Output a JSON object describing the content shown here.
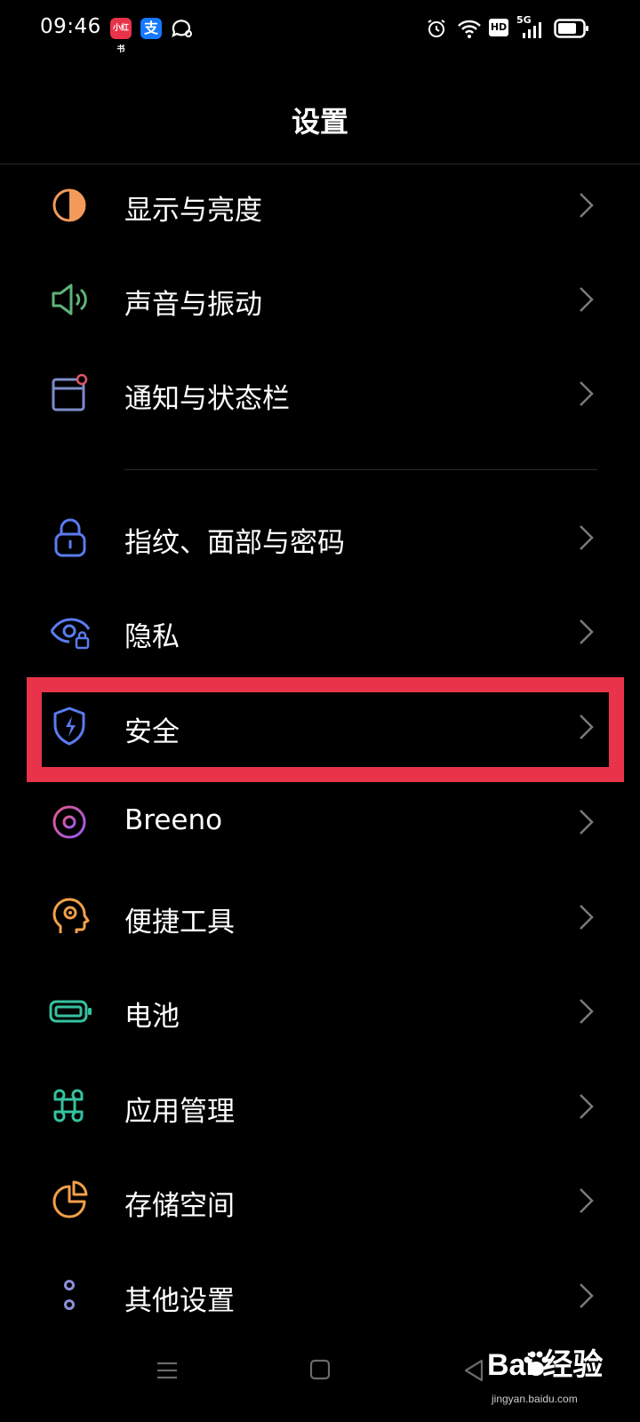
{
  "status_bar": {
    "time": "09:46",
    "apps": [
      {
        "icon": "xiaohongshu-icon",
        "text": "小红书",
        "color": "#e8334a"
      },
      {
        "icon": "alipay-icon",
        "text": "支",
        "color": "#1677ff"
      },
      {
        "icon": "chat-bubble-icon"
      }
    ],
    "right_icons": [
      "alarm-icon",
      "wifi-icon",
      "hd-icon",
      "5g-signal-icon",
      "battery-icon"
    ],
    "hd_text": "HD",
    "signal_text": "5G"
  },
  "header": {
    "title": "设置"
  },
  "items": [
    {
      "label": "显示与亮度",
      "icon": "display-brightness-icon",
      "color": "#f39a5a"
    },
    {
      "label": "声音与振动",
      "icon": "speaker-icon",
      "color": "#5fb37a"
    },
    {
      "label": "通知与状态栏",
      "icon": "notification-icon",
      "color": "#7d8cc9"
    },
    {
      "label": "指纹、面部与密码",
      "icon": "lock-icon",
      "color": "#5b7bf0"
    },
    {
      "label": "隐私",
      "icon": "privacy-eye-icon",
      "color": "#5b7bf0"
    },
    {
      "label": "安全",
      "icon": "security-shield-icon",
      "color": "#5b7bf0"
    },
    {
      "label": "Breeno",
      "icon": "breeno-icon",
      "color": "#c060e0"
    },
    {
      "label": "便捷工具",
      "icon": "convenience-tools-icon",
      "color": "#f3a04a"
    },
    {
      "label": "电池",
      "icon": "battery-icon",
      "color": "#36c2a0"
    },
    {
      "label": "应用管理",
      "icon": "app-management-icon",
      "color": "#36c2a0"
    },
    {
      "label": "存储空间",
      "icon": "storage-icon",
      "color": "#f3a04a"
    },
    {
      "label": "其他设置",
      "icon": "other-settings-icon",
      "color": "#8b8fd6"
    }
  ],
  "highlight_color": "#e8334a",
  "nav_bar": {
    "buttons": [
      "menu-icon",
      "home-icon",
      "back-icon"
    ]
  },
  "watermark": {
    "brand": "Bai  经验",
    "url": "jingyan.baidu.com"
  }
}
